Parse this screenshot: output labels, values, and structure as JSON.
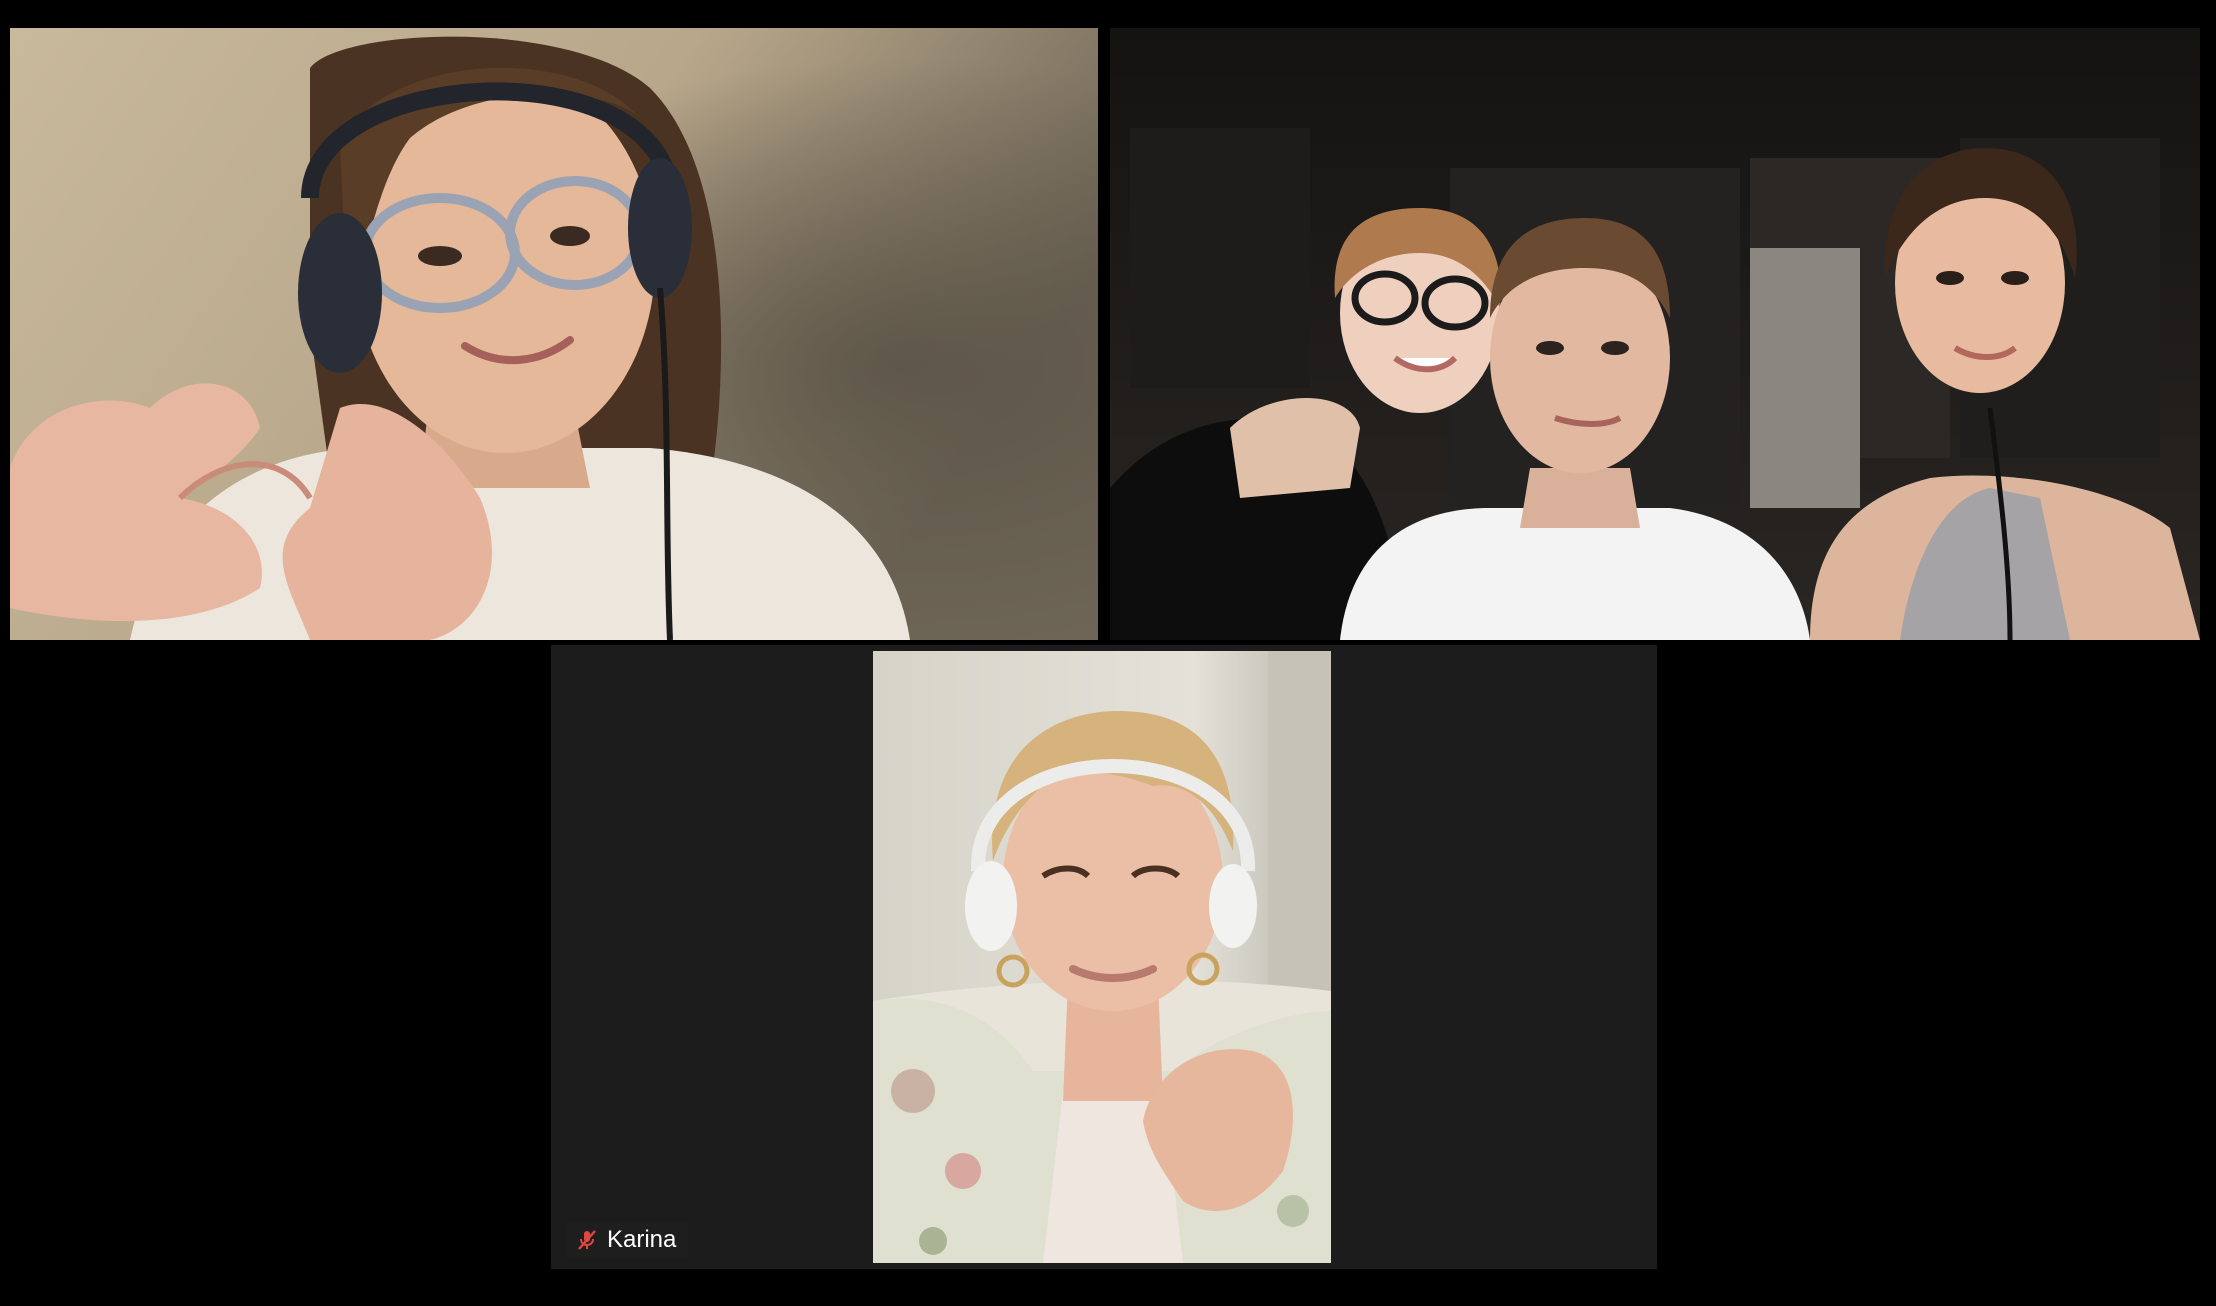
{
  "meeting": {
    "layout": "gallery-view",
    "accent_color": "#c6d977",
    "tiles": [
      {
        "id": "participant-1",
        "active_speaker": false,
        "name_label": ""
      },
      {
        "id": "participant-2",
        "active_speaker": false,
        "name_label": ""
      },
      {
        "id": "participant-3",
        "active_speaker": true,
        "name_label": "Karina",
        "mic_state": "muted",
        "mic_icon": "mic-muted-icon",
        "mic_icon_color": "#e0473e"
      }
    ]
  }
}
